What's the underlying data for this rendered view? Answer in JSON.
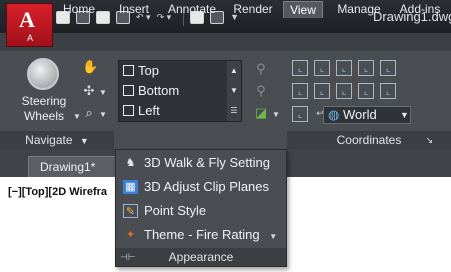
{
  "app": {
    "letter": "A",
    "sub": "A",
    "document_title": "Drawing1.dwg"
  },
  "quick_access": [
    "new-icon",
    "open-icon",
    "save-icon",
    "print-icon",
    "undo-icon",
    "redo-icon",
    "workspace-icon",
    "properties-icon"
  ],
  "tabs": [
    {
      "label": "Home",
      "active": false
    },
    {
      "label": "Insert",
      "active": false
    },
    {
      "label": "Annotate",
      "active": false
    },
    {
      "label": "Render",
      "active": false
    },
    {
      "label": "View",
      "active": true
    },
    {
      "label": "Manage",
      "active": false
    },
    {
      "label": "Add-ins",
      "active": false
    }
  ],
  "navigate_panel": {
    "steering_label_1": "Steering",
    "steering_label_2": "Wheels",
    "panel_label": "Navigate",
    "panel_arrow": "▼"
  },
  "views_panel": {
    "items": [
      "Top",
      "Bottom",
      "Left"
    ]
  },
  "coordinates_panel": {
    "ucs_select": "World",
    "panel_label": "Coordinates"
  },
  "document_tab": {
    "label": "Drawing1*"
  },
  "viewport": {
    "label": "[−][Top][2D Wirefra"
  },
  "dropdown": {
    "items": [
      {
        "label": "3D Walk & Fly Setting",
        "icon": "walk-icon",
        "submenu": false
      },
      {
        "label": "3D Adjust Clip Planes",
        "icon": "clip-planes-icon",
        "submenu": false
      },
      {
        "label": "Point Style",
        "icon": "point-style-icon",
        "submenu": false
      },
      {
        "label": "Theme - Fire Rating",
        "icon": "theme-icon",
        "submenu": true
      }
    ],
    "footer": "Appearance"
  },
  "colors": {
    "ribbon_bg": "#4a4d52",
    "title_bg": "#2b2e33",
    "app_red": "#c8161f",
    "canvas": "#ffffff"
  }
}
